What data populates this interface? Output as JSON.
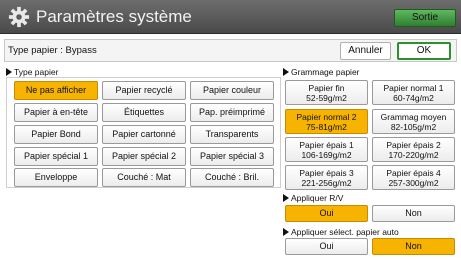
{
  "header": {
    "title": "Paramètres système",
    "exit_label": "Sortie"
  },
  "info": {
    "text": "Type papier : Bypass",
    "cancel_label": "Annuler",
    "ok_label": "OK"
  },
  "paper_type": {
    "label": "Type papier",
    "buttons": [
      "Ne pas afficher",
      "Papier recyclé",
      "Papier couleur",
      "Papier à en-tête",
      "Étiquettes",
      "Pap. préimprimé",
      "Papier Bond",
      "Papier cartonné",
      "Transparents",
      "Papier spécial 1",
      "Papier spécial 2",
      "Papier spécial 3",
      "Enveloppe",
      "Couché : Mat",
      "Couché : Bril."
    ],
    "selected": "Ne pas afficher"
  },
  "paper_weight": {
    "label": "Grammage papier",
    "buttons": [
      {
        "line1": "Papier fin",
        "line2": "52-59g/m2"
      },
      {
        "line1": "Papier normal 1",
        "line2": "60-74g/m2"
      },
      {
        "line1": "Papier normal 2",
        "line2": "75-81g/m2"
      },
      {
        "line1": "Grammag moyen",
        "line2": "82-105g/m2"
      },
      {
        "line1": "Papier épais 1",
        "line2": "106-169g/m2"
      },
      {
        "line1": "Papier épais 2",
        "line2": "170-220g/m2"
      },
      {
        "line1": "Papier épais 3",
        "line2": "221-256g/m2"
      },
      {
        "line1": "Papier épais 4",
        "line2": "257-300g/m2"
      }
    ],
    "selected": "Papier normal 2"
  },
  "duplex": {
    "label": "Appliquer R/V",
    "yes": "Oui",
    "no": "Non",
    "selected": "Oui"
  },
  "auto_select": {
    "label": "Appliquer sélect. papier auto",
    "yes": "Oui",
    "no": "Non",
    "selected": "Non"
  },
  "colors": {
    "selected": "#f6b300",
    "ok_border": "#2f8f2f",
    "exit_button": "#3f9a3f",
    "header_bg": "#5a5a5a"
  }
}
